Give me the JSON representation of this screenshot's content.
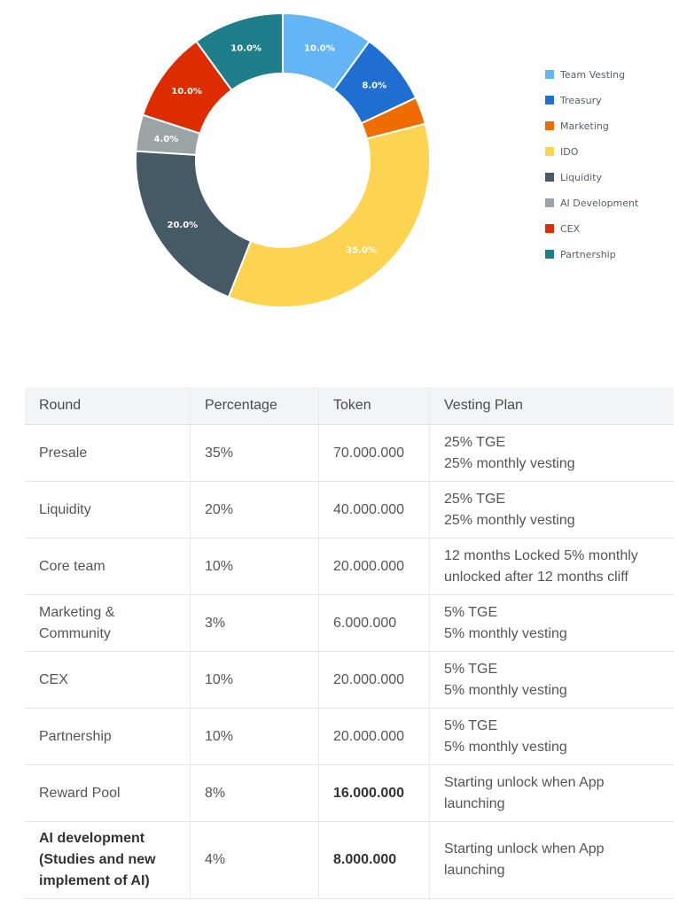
{
  "chart_data": {
    "type": "pie",
    "subtype": "donut",
    "title": "",
    "legend_position": "right",
    "slices": [
      {
        "label": "Team Vesting",
        "value": 10.0,
        "display": "10.0%",
        "color": "#64b5f6"
      },
      {
        "label": "Treasury",
        "value": 8.0,
        "display": "8.0%",
        "color": "#1e6fd0"
      },
      {
        "label": "Marketing",
        "value": 3.0,
        "display": "",
        "color": "#ef6c00"
      },
      {
        "label": "IDO",
        "value": 35.0,
        "display": "35.0%",
        "color": "#fdd451"
      },
      {
        "label": "Liquidity",
        "value": 20.0,
        "display": "20.0%",
        "color": "#455a64"
      },
      {
        "label": "AI Development",
        "value": 4.0,
        "display": "4.0%",
        "color": "#9aa3a6"
      },
      {
        "label": "CEX",
        "value": 10.0,
        "display": "10.0%",
        "color": "#dd2c00"
      },
      {
        "label": "Partnership",
        "value": 10.0,
        "display": "10.0%",
        "color": "#1e7e8a"
      }
    ],
    "legend": [
      "Team Vesting",
      "Treasury",
      "Marketing",
      "IDO",
      "Liquidity",
      "AI Development",
      "CEX",
      "Partnership"
    ]
  },
  "table": {
    "headers": [
      "Round",
      "Percentage",
      "Token",
      "Vesting Plan"
    ],
    "rows": [
      {
        "round": "Presale",
        "percentage": "35%",
        "token": "70.000.000",
        "vesting": [
          "25% TGE",
          "25% monthly vesting"
        ],
        "bold_round": false,
        "bold_token": false
      },
      {
        "round": "Liquidity",
        "percentage": "20%",
        "token": "40.000.000",
        "vesting": [
          "25% TGE",
          "25% monthly vesting"
        ],
        "bold_round": false,
        "bold_token": false
      },
      {
        "round": "Core team",
        "percentage": "10%",
        "token": "20.000.000",
        "vesting": [
          "12 months Locked  5% monthly",
          "unlocked after 12 months cliff"
        ],
        "bold_round": false,
        "bold_token": false
      },
      {
        "round": "Marketing & Community",
        "percentage": "3%",
        "token": "6.000.000",
        "vesting": [
          "5% TGE",
          "5% monthly vesting"
        ],
        "bold_round": false,
        "bold_token": false
      },
      {
        "round": "CEX",
        "percentage": "10%",
        "token": "20.000.000",
        "vesting": [
          "5% TGE",
          "5% monthly vesting"
        ],
        "bold_round": false,
        "bold_token": false
      },
      {
        "round": "Partnership",
        "percentage": "10%",
        "token": "20.000.000",
        "vesting": [
          "5% TGE",
          "5% monthly vesting"
        ],
        "bold_round": false,
        "bold_token": false
      },
      {
        "round": "Reward Pool",
        "percentage": "8%",
        "token": "16.000.000",
        "vesting": [
          "Starting unlock when App",
          "launching"
        ],
        "bold_round": false,
        "bold_token": true
      },
      {
        "round": "AI development (Studies and new implement of AI)",
        "percentage": "4%",
        "token": "8.000.000",
        "vesting": [
          "Starting unlock when App",
          "launching"
        ],
        "bold_round": true,
        "bold_token": true
      }
    ]
  }
}
